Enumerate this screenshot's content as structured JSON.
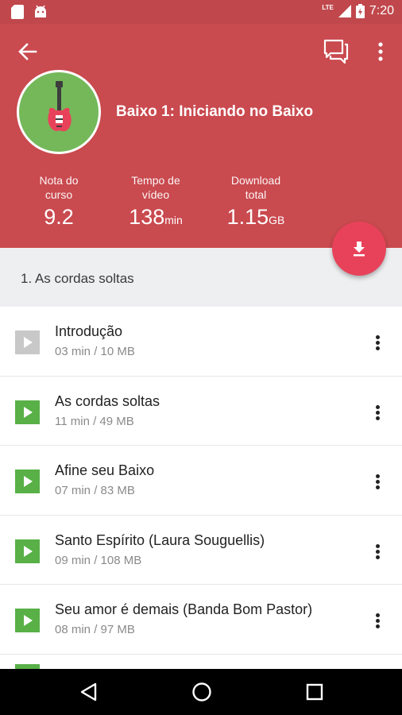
{
  "status_bar": {
    "network": "LTE",
    "time": "7:20"
  },
  "course": {
    "title": "Baixo 1: Iniciando no Baixo"
  },
  "stats": [
    {
      "label": "Nota do\ncurso",
      "value": "9.2",
      "unit": ""
    },
    {
      "label": "Tempo de\nvídeo",
      "value": "138",
      "unit": "min"
    },
    {
      "label": "Download\ntotal",
      "value": "1.15",
      "unit": "GB"
    }
  ],
  "section": {
    "title": "1. As cordas soltas"
  },
  "lessons": [
    {
      "title": "Introdução",
      "meta": "03 min / 10 MB",
      "watched": true
    },
    {
      "title": "As cordas soltas",
      "meta": "11 min / 49 MB",
      "watched": false
    },
    {
      "title": "Afine seu Baixo",
      "meta": "07 min / 83 MB",
      "watched": false
    },
    {
      "title": "Santo Espírito (Laura Souguellis)",
      "meta": "09 min / 108 MB",
      "watched": false
    },
    {
      "title": "Seu amor é demais (Banda Bom Pastor)",
      "meta": "08 min / 97 MB",
      "watched": false
    }
  ],
  "colors": {
    "header": "#c94a4f",
    "fab": "#e8425a",
    "play": "#58b047",
    "play_watched": "#c8c8c8",
    "avatar_bg": "#74b85a"
  },
  "icons": {
    "back": "arrow-left-icon",
    "chat": "chat-icon",
    "more": "more-vert-icon",
    "download": "download-icon",
    "play": "play-icon"
  }
}
